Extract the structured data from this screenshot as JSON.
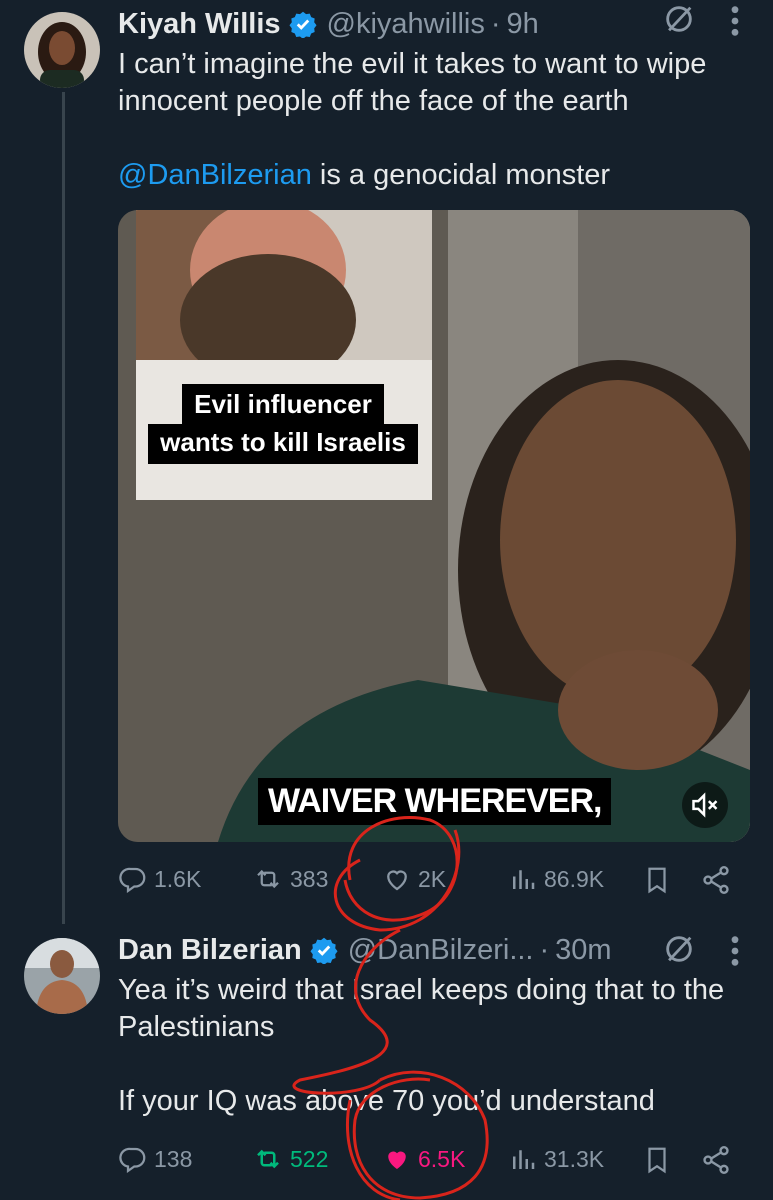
{
  "tweet1": {
    "name": "Kiyah Willis",
    "handle": "@kiyahwillis",
    "dot": "·",
    "time": "9h",
    "text_line1": "I can’t imagine the evil it takes to want to wipe innocent people off the face of the earth",
    "mention": "@DanBilzerian",
    "text_line2_rest": " is a genocidal monster",
    "media": {
      "caption_top_line1": "Evil influencer",
      "caption_top_line2": "wants to kill Israelis",
      "subtitle": "WAIVER WHEREVER,"
    },
    "stats": {
      "replies": "1.6K",
      "reposts": "383",
      "likes": "2K",
      "views": "86.9K"
    }
  },
  "tweet2": {
    "name": "Dan Bilzerian",
    "handle": "@DanBilzeri...",
    "dot": "·",
    "time": "30m",
    "text_line1": "Yea it’s weird that Israel keeps doing that to the Palestinians",
    "text_line2": "If your IQ was above 70 you’d understand",
    "stats": {
      "replies": "138",
      "reposts": "522",
      "likes": "6.5K",
      "views": "31.3K"
    }
  },
  "colors": {
    "background": "#15202b",
    "text": "#e7e9ea",
    "muted": "#8b98a5",
    "accent": "#1d9bf0",
    "repost_active": "#00ba7c",
    "like_active": "#f91880",
    "annotation": "#d9241b"
  },
  "icons": [
    "verified-badge-icon",
    "grok-icon",
    "more-icon",
    "reply-icon",
    "repost-icon",
    "like-icon",
    "views-icon",
    "bookmark-icon",
    "share-icon",
    "mute-icon"
  ]
}
